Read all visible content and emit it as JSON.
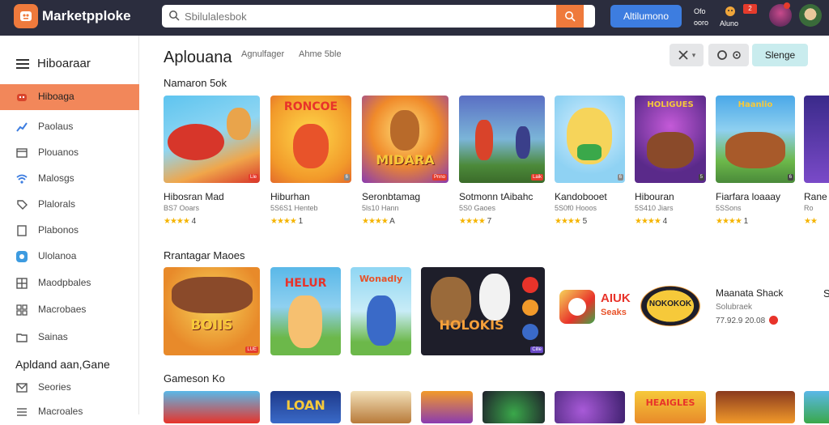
{
  "app": {
    "name": "Marketpploke"
  },
  "search": {
    "placeholder": "Sbilulalesbok"
  },
  "header": {
    "button_label": "Altilumono",
    "status1_line1": "Ofo",
    "status1_line2": "ooro",
    "status2_label": "Aluno",
    "badge_count": "2"
  },
  "sidebar": {
    "title": "Hiboaraar",
    "items": [
      {
        "label": "Hiboaga",
        "icon": "gamepad-icon"
      },
      {
        "label": "Paolaus",
        "icon": "chart-icon"
      },
      {
        "label": "Plouanos",
        "icon": "window-icon"
      },
      {
        "label": "Malosgs",
        "icon": "wifi-icon"
      },
      {
        "label": "Plalorals",
        "icon": "tag-icon"
      },
      {
        "label": "Plabonos",
        "icon": "bookmark-icon"
      },
      {
        "label": "Ulolanoa",
        "icon": "circle-icon"
      },
      {
        "label": "Maodpbales",
        "icon": "grid-icon"
      },
      {
        "label": "Macrobaes",
        "icon": "apps-icon"
      },
      {
        "label": "Sainas",
        "icon": "folder-icon"
      }
    ],
    "section_title": "Apldand aan,Gane",
    "section_items": [
      {
        "label": "Seories",
        "icon": "mail-icon"
      },
      {
        "label": "Macroales",
        "icon": "list-icon"
      }
    ]
  },
  "main": {
    "title": "Aplouana",
    "breadcrumbs": [
      "Agnulfager",
      "Ahme 5ble"
    ],
    "toolbar": {
      "filter_caret": "▾",
      "primary_label": "Slenge"
    }
  },
  "sections": [
    {
      "title": "Namaron 5ok"
    },
    {
      "title": "Rrantagar Maoes"
    },
    {
      "title": "Gameson Ko"
    }
  ],
  "row1": [
    {
      "name": "Hibosran Mad",
      "sub": "BS7 Ooars",
      "rating": "4",
      "art": "",
      "badge": "Lle"
    },
    {
      "name": "Hiburhan",
      "sub": "5S6S1 Henteb",
      "rating": "1",
      "art": "RONCOE",
      "badge": "6"
    },
    {
      "name": "Seronbtamag",
      "sub": "5ls10 Hann",
      "rating": "A",
      "art": "MIDARA",
      "badge": "Pnno"
    },
    {
      "name": "Sotmonn tAibahc",
      "sub": "5S0 Gaoes",
      "rating": "7",
      "art": "",
      "badge": "Laik"
    },
    {
      "name": "Kandobooet",
      "sub": "5S0f0 Hooos",
      "rating": "5",
      "art": "",
      "badge": "6"
    },
    {
      "name": "Hibouran",
      "sub": "5S410 Jiars",
      "rating": "4",
      "art": "HOLIGUES",
      "badge": "5"
    },
    {
      "name": "Fiarfara loaaay",
      "sub": "5SSons",
      "rating": "1",
      "art": "Haanlio",
      "badge": "6"
    },
    {
      "name": "Rane",
      "sub": "Ro",
      "rating": "",
      "art": "",
      "badge": ""
    }
  ],
  "row2": [
    {
      "art": "BOIIS",
      "badge": "LUE"
    },
    {
      "art": "HELUR",
      "badge": ""
    },
    {
      "art": "Wonadly",
      "badge": ""
    },
    {
      "art": "HOLOKIS",
      "badge": "Cille"
    }
  ],
  "featured": {
    "logo1_line1": "AIUK",
    "logo1_line2": "Seaks",
    "logo2_text": "NOKOKOK",
    "name": "Maanata Shack",
    "sub": "Solubraek",
    "meta": "77.92.9 20.08",
    "edge": "S"
  },
  "row3": [
    {
      "art": ""
    },
    {
      "art": "LOAN"
    },
    {
      "art": ""
    },
    {
      "art": ""
    },
    {
      "art": ""
    },
    {
      "art": ""
    },
    {
      "art": "HEAIGLES"
    },
    {
      "art": ""
    },
    {
      "art": ""
    }
  ],
  "colors": {
    "topbar": "#2b2d3e",
    "accent_orange": "#ef7a3c",
    "sidebar_active": "#f2875a",
    "primary_blue": "#3d7de0",
    "toolbar_teal": "#c9ecee",
    "star_gold": "#f5b400"
  }
}
